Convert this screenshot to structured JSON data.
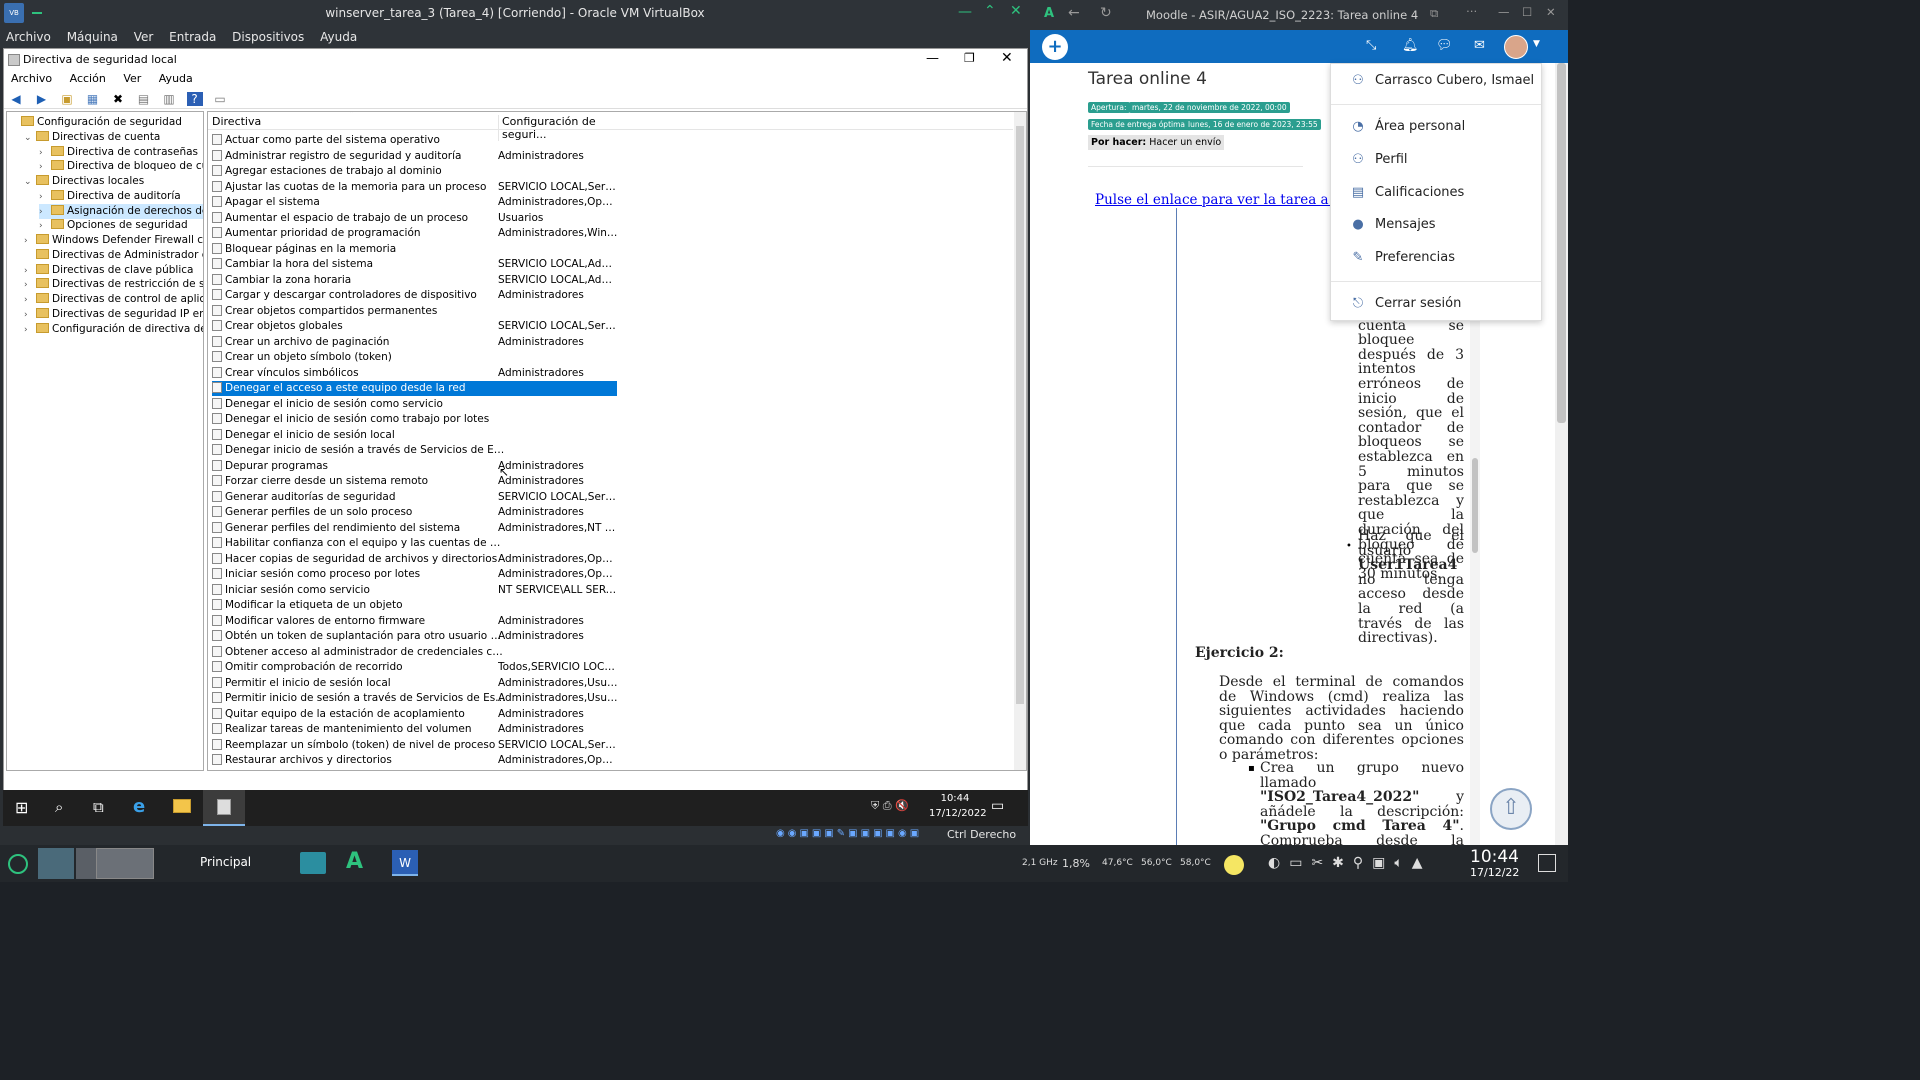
{
  "vbox": {
    "title": "winserver_tarea_3 (Tarea_4) [Corriendo] - Oracle VM VirtualBox",
    "menu": [
      "Archivo",
      "Máquina",
      "Ver",
      "Entrada",
      "Dispositivos",
      "Ayuda"
    ],
    "status_right": "Ctrl Derecho"
  },
  "secpol": {
    "title": "Directiva de seguridad local",
    "menu": [
      "Archivo",
      "Acción",
      "Ver",
      "Ayuda"
    ],
    "tree": [
      {
        "label": "Configuración de seguridad",
        "level": 0,
        "expand": ""
      },
      {
        "label": "Directivas de cuenta",
        "level": 1,
        "expand": "v"
      },
      {
        "label": "Directiva de contraseñas",
        "level": 2,
        "expand": ">"
      },
      {
        "label": "Directiva de bloqueo de cuenta",
        "level": 2,
        "expand": ">"
      },
      {
        "label": "Directivas locales",
        "level": 1,
        "expand": "v"
      },
      {
        "label": "Directiva de auditoría",
        "level": 2,
        "expand": ">"
      },
      {
        "label": "Asignación de derechos de usuario",
        "level": 2,
        "expand": ">",
        "selected": true
      },
      {
        "label": "Opciones de seguridad",
        "level": 2,
        "expand": ">"
      },
      {
        "label": "Windows Defender Firewall con seguridad",
        "level": 1,
        "expand": ">"
      },
      {
        "label": "Directivas de Administrador de listas de",
        "level": 1,
        "expand": ""
      },
      {
        "label": "Directivas de clave pública",
        "level": 1,
        "expand": ">"
      },
      {
        "label": "Directivas de restricción de software",
        "level": 1,
        "expand": ">"
      },
      {
        "label": "Directivas de control de aplicaciones",
        "level": 1,
        "expand": ">"
      },
      {
        "label": "Directivas de seguridad IP en Equipo local",
        "level": 1,
        "expand": ">"
      },
      {
        "label": "Configuración de directiva de auditoría",
        "level": 1,
        "expand": ">"
      }
    ],
    "columns": [
      "Directiva",
      "Configuración de seguri..."
    ],
    "rows": [
      [
        "Actuar como parte del sistema operativo",
        ""
      ],
      [
        "Administrar registro de seguridad y auditoría",
        "Administradores"
      ],
      [
        "Agregar estaciones de trabajo al dominio",
        ""
      ],
      [
        "Ajustar las cuotas de la memoria para un proceso",
        "SERVICIO LOCAL,Servici..."
      ],
      [
        "Apagar el sistema",
        "Administradores,Operad..."
      ],
      [
        "Aumentar el espacio de trabajo de un proceso",
        "Usuarios"
      ],
      [
        "Aumentar prioridad de programación",
        "Administradores,Windo..."
      ],
      [
        "Bloquear páginas en la memoria",
        ""
      ],
      [
        "Cambiar la hora del sistema",
        "SERVICIO LOCAL,Admin..."
      ],
      [
        "Cambiar la zona horaria",
        "SERVICIO LOCAL,Admin..."
      ],
      [
        "Cargar y descargar controladores de dispositivo",
        "Administradores"
      ],
      [
        "Crear objetos compartidos permanentes",
        ""
      ],
      [
        "Crear objetos globales",
        "SERVICIO LOCAL,Servici..."
      ],
      [
        "Crear un archivo de paginación",
        "Administradores"
      ],
      [
        "Crear un objeto símbolo (token)",
        ""
      ],
      [
        "Crear vínculos simbólicos",
        "Administradores"
      ],
      [
        "Denegar el acceso a este equipo desde la red",
        ""
      ],
      [
        "Denegar el inicio de sesión como servicio",
        ""
      ],
      [
        "Denegar el inicio de sesión como trabajo por lotes",
        ""
      ],
      [
        "Denegar el inicio de sesión local",
        ""
      ],
      [
        "Denegar inicio de sesión a través de Servicios de Escritorio re...",
        ""
      ],
      [
        "Depurar programas",
        "Administradores"
      ],
      [
        "Forzar cierre desde un sistema remoto",
        "Administradores"
      ],
      [
        "Generar auditorías de seguridad",
        "SERVICIO LOCAL,Servici..."
      ],
      [
        "Generar perfiles de un solo proceso",
        "Administradores"
      ],
      [
        "Generar perfiles del rendimiento del sistema",
        "Administradores,NT SER..."
      ],
      [
        "Habilitar confianza con el equipo y las cuentas de usuario p...",
        ""
      ],
      [
        "Hacer copias de seguridad de archivos y directorios",
        "Administradores,Operad..."
      ],
      [
        "Iniciar sesión como proceso por lotes",
        "Administradores,Operad..."
      ],
      [
        "Iniciar sesión como servicio",
        "NT SERVICE\\ALL SERVIC..."
      ],
      [
        "Modificar la etiqueta de un objeto",
        ""
      ],
      [
        "Modificar valores de entorno firmware",
        "Administradores"
      ],
      [
        "Obtén un token de suplantación para otro usuario en la mis...",
        "Administradores"
      ],
      [
        "Obtener acceso al administrador de credenciales como un ll...",
        ""
      ],
      [
        "Omitir comprobación de recorrido",
        "Todos,SERVICIO LOCAL,..."
      ],
      [
        "Permitir el inicio de sesión local",
        "Administradores,Usuari..."
      ],
      [
        "Permitir inicio de sesión a través de Servicios de Escritorio re...",
        "Administradores,Usuari..."
      ],
      [
        "Quitar equipo de la estación de acoplamiento",
        "Administradores"
      ],
      [
        "Realizar tareas de mantenimiento del volumen",
        "Administradores"
      ],
      [
        "Reemplazar un símbolo (token) de nivel de proceso",
        "SERVICIO LOCAL,Servici..."
      ],
      [
        "Restaurar archivos y directorios",
        "Administradores,Operad..."
      ]
    ],
    "selected_row": 16
  },
  "guest_taskbar": {
    "time": "10:44",
    "date": "17/12/2022"
  },
  "host_taskbar": {
    "workspace": "Principal",
    "cpu_freq": "2,1 GHz",
    "cpu_load": "1,8%",
    "temps": [
      "47,6°C",
      "56,0°C",
      "58,0°C"
    ],
    "time": "10:44",
    "date": "17/12/22"
  },
  "browser": {
    "title": "Moodle - ASIR/AGUA2_ISO_2223: Tarea online 4",
    "page_title": "Tarea online 4",
    "badges": {
      "apertura_label": "Apertura:",
      "apertura_value": "martes, 22 de noviembre de 2022, 00:00",
      "entrega_label": "Fecha de entrega óptima:",
      "entrega_value": "lunes, 16 de enero de 2023, 23:55"
    },
    "por_hacer_label": "Por hacer:",
    "por_hacer_value": "Hacer un envío",
    "link_text": "Pulse el enlace para ver la tarea a pantalla co",
    "dropdown": {
      "user": "Carrasco Cubero, Ismael",
      "items": [
        "Área personal",
        "Perfil",
        "Calificaciones",
        "Mensajes",
        "Preferencias"
      ],
      "logout": "Cerrar sesión"
    },
    "text_block1": "Haz que la cuenta se bloquee después de 3 intentos erróneos de inicio de sesión, que el contador de bloqueos se establezca en 5 minutos para que se restablezca y que la duración del bloqueo de cuenta sea de 30 minutos.",
    "bullet2_pre": "Haz que el usuario",
    "bullet2_bold": "User1Tarea4",
    "bullet2_post": "no tenga acceso desde la red (a través de las directivas).",
    "ejercicio2": "Ejercicio 2:",
    "ej2_text": "Desde el terminal de comandos de Windows (cmd) realiza las siguientes actividades haciendo que cada punto sea un único comando con diferentes opciones o parámetros:",
    "ej2_b1_pre": "Crea un grupo nuevo llamado",
    "ej2_b1_bold1": "\"ISO2_Tarea4_2022\"",
    "ej2_b1_mid": "y añádele la descripción:",
    "ej2_b1_bold2": "\"Grupo cmd Tarea 4\"",
    "ej2_b1_post": ". Comprueba desde la interfaz gráfica el resultado."
  },
  "colors": {
    "accent": "#0f6cbf",
    "selection": "#0078d7",
    "badge": "#2b9e8f"
  }
}
